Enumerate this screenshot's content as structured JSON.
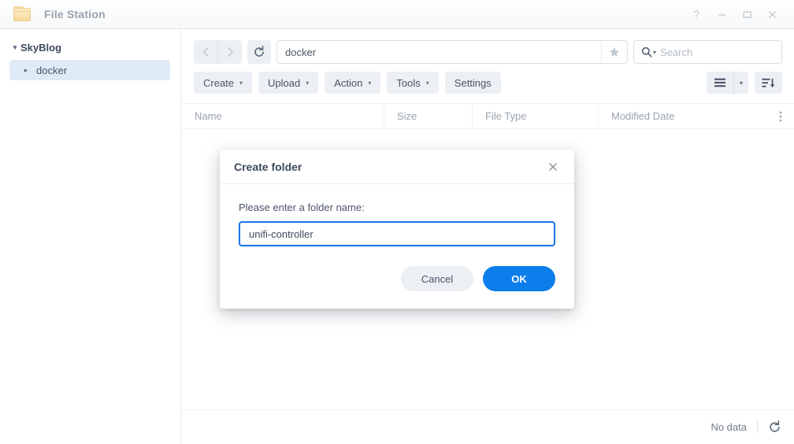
{
  "window": {
    "title": "File Station",
    "icon": "folder-icon",
    "controls": [
      {
        "name": "help-button",
        "glyph": "?"
      },
      {
        "name": "minimize-button",
        "glyph": "–"
      },
      {
        "name": "maximize-button",
        "glyph": "▭"
      },
      {
        "name": "close-button",
        "glyph": "✕"
      }
    ]
  },
  "sidebar": {
    "root": {
      "label": "SkyBlog",
      "expanded": true,
      "caret": "▾"
    },
    "items": [
      {
        "label": "docker",
        "selected": true,
        "caret": "▸"
      }
    ]
  },
  "navbar": {
    "back_icon": "chevron-left-icon",
    "forward_icon": "chevron-right-icon",
    "reload_icon": "refresh-icon",
    "path_value": "docker",
    "favorite_icon": "star-icon",
    "search_icon": "search-icon",
    "search_caret": "▾",
    "search_placeholder": "Search",
    "search_value": ""
  },
  "toolbar": {
    "buttons": [
      {
        "label": "Create",
        "caret": "▾"
      },
      {
        "label": "Upload",
        "caret": "▾"
      },
      {
        "label": "Action",
        "caret": "▾"
      },
      {
        "label": "Tools",
        "caret": "▾"
      },
      {
        "label": "Settings",
        "caret": ""
      }
    ],
    "view_mode_icon": "list-view-icon",
    "view_mode_caret": "▾",
    "sort_icon": "sort-descending-icon"
  },
  "table": {
    "columns": [
      "Name",
      "Size",
      "File Type",
      "Modified Date"
    ],
    "column_menu_icon": "more-vertical-icon",
    "rows": []
  },
  "statusbar": {
    "text": "No data",
    "reload_icon": "refresh-icon"
  },
  "dialog": {
    "title": "Create folder",
    "close_icon": "close-icon",
    "label": "Please enter a folder name:",
    "input_value": "unifi-controller",
    "input_placeholder": "",
    "cancel_label": "Cancel",
    "ok_label": "OK"
  },
  "colors": {
    "accent": "#0b7eeb",
    "focus_border": "#1a73e8",
    "selection": "#dfeaf7",
    "toolbar_button": "#eceff3",
    "text": "#4a5568",
    "muted_text": "#9aa3ad"
  }
}
